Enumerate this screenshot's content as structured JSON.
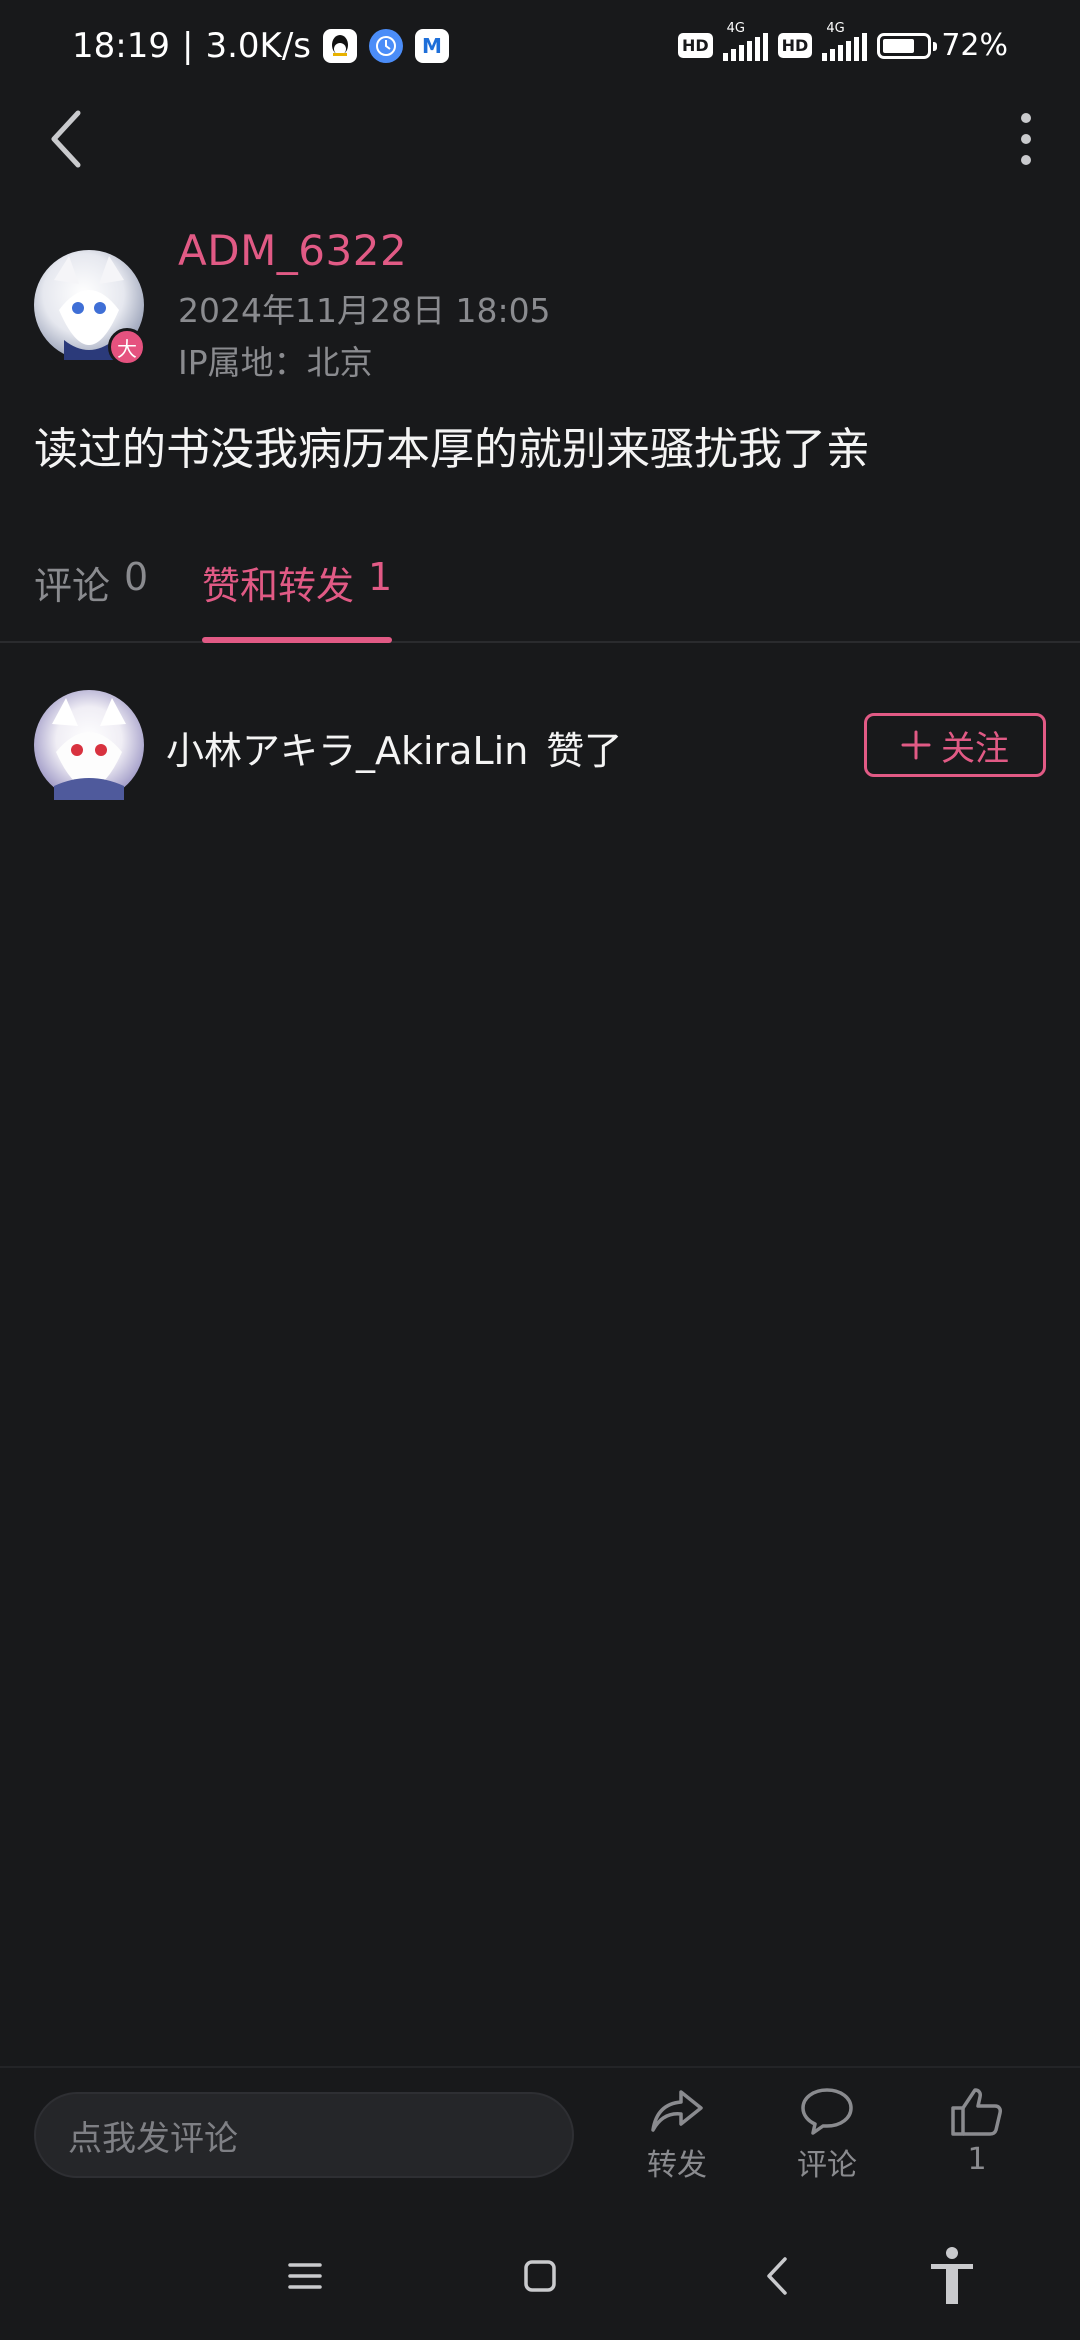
{
  "status_bar": {
    "time": "18:19",
    "speed": "3.0K/s",
    "network1": "4G",
    "network2": "4G",
    "hd": "HD",
    "battery_percent": 72,
    "battery_text": "72%"
  },
  "post": {
    "author": "ADM_6322",
    "badge": "大",
    "time": "2024年11月28日 18:05",
    "ip": "IP属地：北京",
    "content": "读过的书没我病历本厚的就别来骚扰我了亲"
  },
  "tabs": [
    {
      "label": "评论",
      "count": "0"
    },
    {
      "label": "赞和转发",
      "count": "1"
    }
  ],
  "likes": [
    {
      "user": "小林アキラ_AkiraLin",
      "action": "赞了",
      "follow_label": "关注"
    }
  ],
  "bottom_bar": {
    "input_placeholder": "点我发评论",
    "forward_label": "转发",
    "comment_label": "评论",
    "like_count": "1"
  },
  "colors": {
    "accent": "#e15a85",
    "background": "#18191b",
    "muted": "#8a8b8f"
  }
}
